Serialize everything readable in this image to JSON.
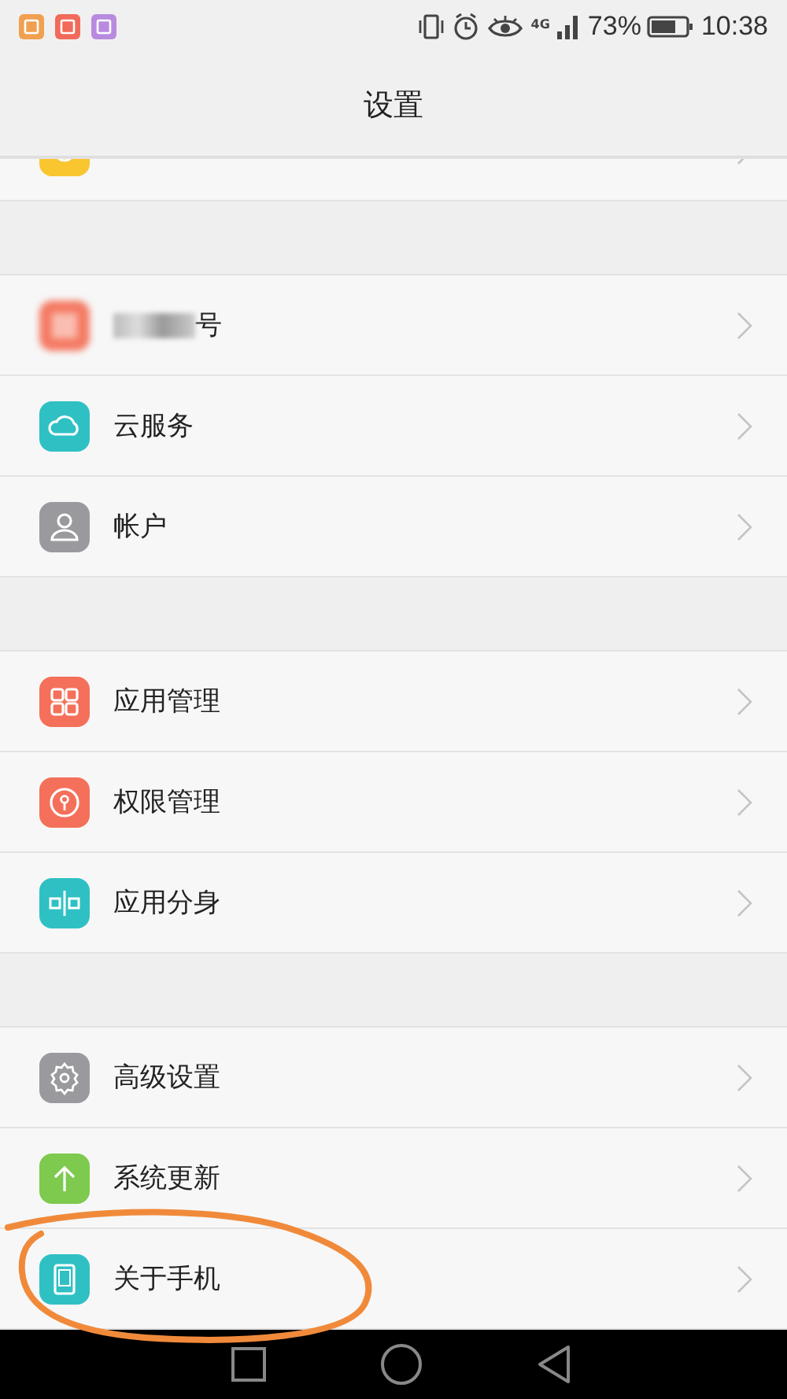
{
  "status_bar": {
    "battery": "73%",
    "time": "10:38",
    "network": "4G"
  },
  "title": "设置",
  "sections": [
    {
      "items": [
        {
          "color": "#f9c630",
          "cut": true
        }
      ]
    },
    {
      "items": [
        {
          "label": "号",
          "color": "#f47a63",
          "blurred": true
        },
        {
          "label": "云服务",
          "color": "#2fc0c4"
        },
        {
          "label": "帐户",
          "color": "#9a9a9e"
        }
      ]
    },
    {
      "items": [
        {
          "label": "应用管理",
          "color": "#f4705a"
        },
        {
          "label": "权限管理",
          "color": "#f4705a"
        },
        {
          "label": "应用分身",
          "color": "#2fc0c4"
        }
      ]
    },
    {
      "items": [
        {
          "label": "高级设置",
          "color": "#9a9a9e"
        },
        {
          "label": "系统更新",
          "color": "#7dca4e"
        },
        {
          "label": "关于手机",
          "color": "#2fc0c4",
          "circled": true
        }
      ]
    }
  ]
}
